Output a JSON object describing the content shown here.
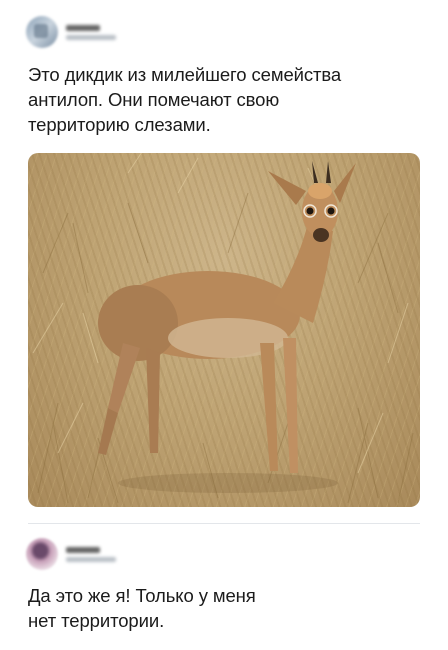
{
  "posts": [
    {
      "text_lines": [
        "Это дикдик из милейшего семейства",
        "антилоп. Они помечают свою",
        "территорию слезами."
      ],
      "image": "dik-dik-antelope-photo"
    },
    {
      "text_lines": [
        "Да это же я! Только у меня",
        "нет территории."
      ]
    }
  ],
  "colors": {
    "background": "#ffffff",
    "text": "#1b1b1b",
    "divider": "#e3e6ea",
    "grass": "#bfa474",
    "antelope": "#b98a5a"
  }
}
